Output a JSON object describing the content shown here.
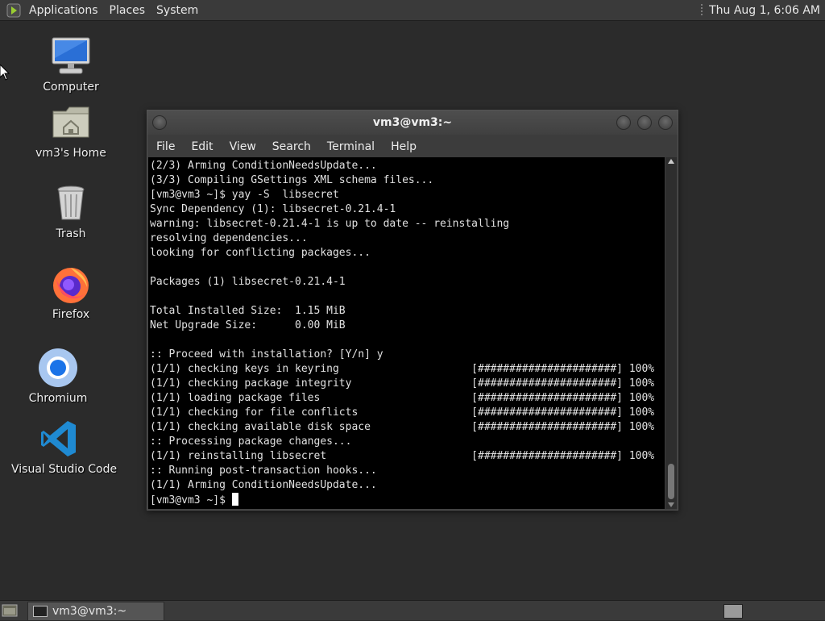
{
  "top_panel": {
    "menus": [
      "Applications",
      "Places",
      "System"
    ],
    "clock": "Thu Aug  1,  6:06 AM"
  },
  "desktop": {
    "icons": [
      {
        "label": "Computer",
        "icon": "computer-icon"
      },
      {
        "label": "vm3's Home",
        "icon": "home-folder-icon"
      },
      {
        "label": "Trash",
        "icon": "trash-icon"
      },
      {
        "label": "Firefox",
        "icon": "firefox-icon"
      },
      {
        "label": "Chromium",
        "icon": "chromium-icon"
      },
      {
        "label": "Visual Studio Code",
        "icon": "vscode-icon"
      }
    ]
  },
  "terminal": {
    "title": "vm3@vm3:~",
    "menu": [
      "File",
      "Edit",
      "View",
      "Search",
      "Terminal",
      "Help"
    ],
    "lines": [
      "(2/3) Arming ConditionNeedsUpdate...",
      "(3/3) Compiling GSettings XML schema files...",
      "[vm3@vm3 ~]$ yay -S  libsecret",
      "Sync Dependency (1): libsecret-0.21.4-1",
      "warning: libsecret-0.21.4-1 is up to date -- reinstalling",
      "resolving dependencies...",
      "looking for conflicting packages...",
      "",
      "Packages (1) libsecret-0.21.4-1",
      "",
      "Total Installed Size:  1.15 MiB",
      "Net Upgrade Size:      0.00 MiB",
      "",
      ":: Proceed with installation? [Y/n] y",
      "(1/1) checking keys in keyring                     [######################] 100%",
      "(1/1) checking package integrity                   [######################] 100%",
      "(1/1) loading package files                        [######################] 100%",
      "(1/1) checking for file conflicts                  [######################] 100%",
      "(1/1) checking available disk space                [######################] 100%",
      ":: Processing package changes...",
      "(1/1) reinstalling libsecret                       [######################] 100%",
      ":: Running post-transaction hooks...",
      "(1/1) Arming ConditionNeedsUpdate..."
    ],
    "prompt": "[vm3@vm3 ~]$ "
  },
  "taskbar": {
    "window_title": "vm3@vm3:~"
  }
}
